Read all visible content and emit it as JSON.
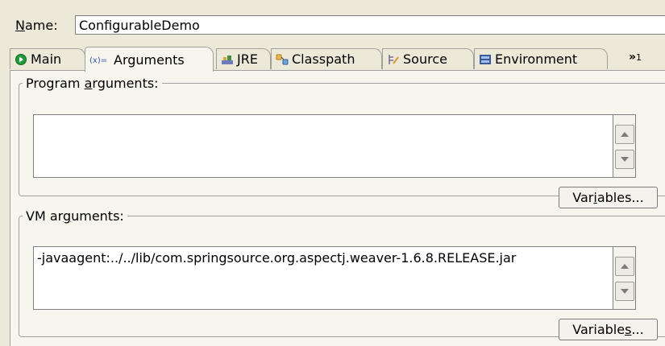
{
  "name_row": {
    "label_mnemonic": "N",
    "label_rest": "ame:",
    "value": "ConfigurableDemo"
  },
  "tabs": [
    {
      "label": "Main",
      "icon": "main-run-icon",
      "active": false
    },
    {
      "label": "Arguments",
      "icon": "arguments-icon",
      "active": true
    },
    {
      "label": "JRE",
      "icon": "jre-icon",
      "active": false
    },
    {
      "label": "Classpath",
      "icon": "classpath-icon",
      "active": false
    },
    {
      "label": "Source",
      "icon": "source-icon",
      "active": false
    },
    {
      "label": "Environment",
      "icon": "environment-icon",
      "active": false
    }
  ],
  "tab_overflow": {
    "label": "»",
    "count": "1"
  },
  "program_arguments": {
    "label_pre": "Program ",
    "label_mnemonic": "a",
    "label_post": "rguments:",
    "value": "",
    "variables_pre": "Var",
    "variables_mnemonic": "i",
    "variables_post": "ables..."
  },
  "vm_arguments": {
    "label_pre": "VM ar",
    "label_mnemonic": "g",
    "label_post": "uments:",
    "value": "-javaagent:../../lib/com.springsource.org.aspectj.weaver-1.6.8.RELEASE.jar",
    "variables_pre": "Variable",
    "variables_mnemonic": "s",
    "variables_post": "..."
  },
  "colors": {
    "background": "#ece9d8",
    "panel": "#f6f5ee",
    "border": "#a0a0a0"
  }
}
